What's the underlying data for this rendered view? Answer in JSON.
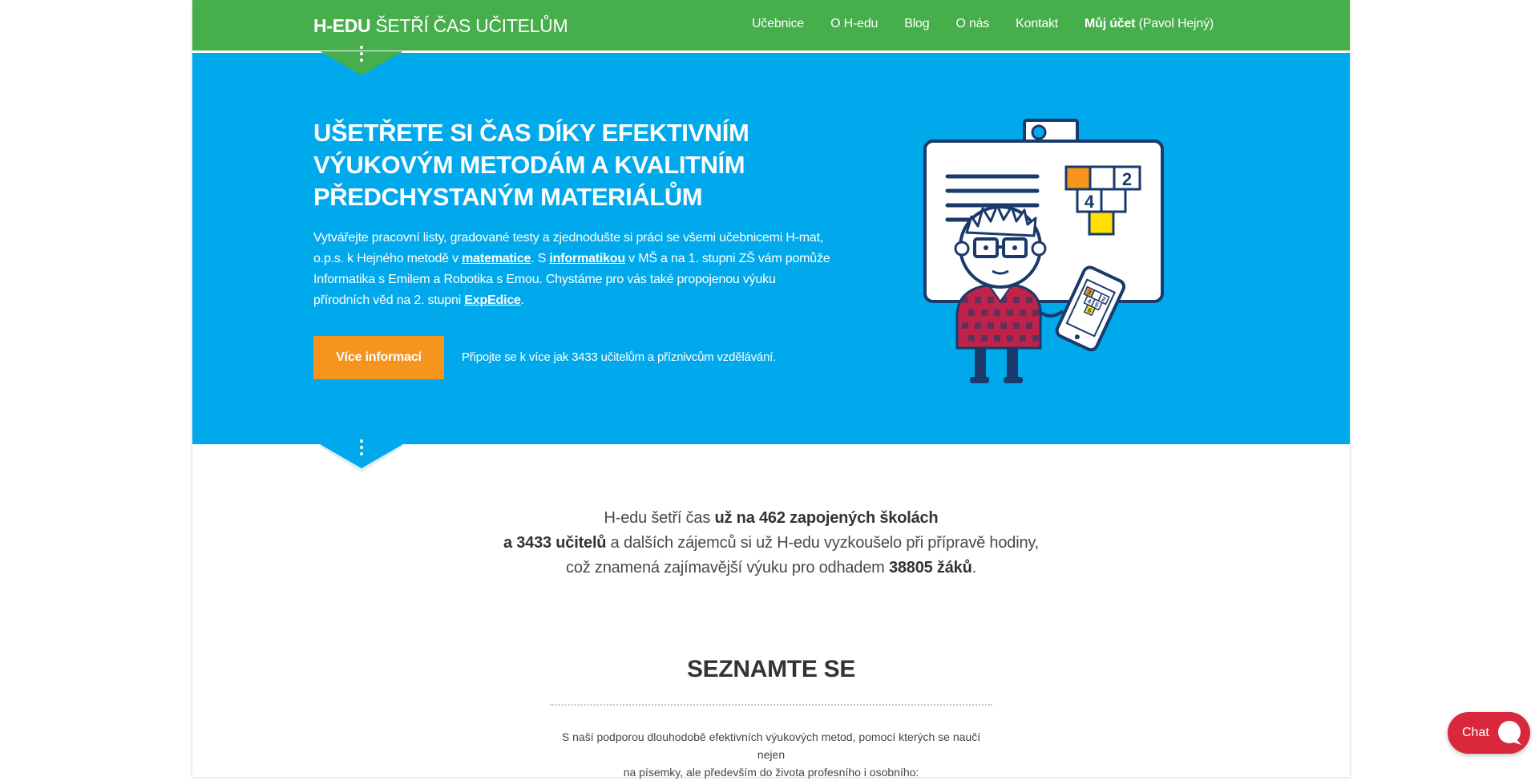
{
  "header": {
    "brand": "H-EDU",
    "tagline": "ŠETŘÍ ČAS UČITELŮM",
    "nav": [
      {
        "label": "Učebnice"
      },
      {
        "label": "O H-edu"
      },
      {
        "label": "Blog"
      },
      {
        "label": "O nás"
      },
      {
        "label": "Kontakt"
      }
    ],
    "account": {
      "label": "Můj účet",
      "user": "(Pavol Hejný)"
    }
  },
  "hero": {
    "title": "Ušetřete si čas díky efektivním výukovým metodám a kvalitním předchystaným materiálům",
    "intro": {
      "part1": "Vytvářejte pracovní listy, gradované testy a zjednodušte si práci se všemi učebnicemi H-mat, o.p.s. k Hejného metodě v ",
      "link1": "matematice",
      "part2": ". S ",
      "link2": "informatikou",
      "part3": " v MŠ a na 1. stupni ZŠ vám pomůže Informatika s Emilem a Robotika s Emou. Chystáme pro vás také propojenou výuku přírodních věd na 2. stupni ",
      "link3": "ExpEdice",
      "part4": "."
    },
    "cta_label": "Více informací",
    "join_text": "Připojte se k více jak 3433 učitelům a příznivcům vzdělávání.",
    "illustration": {
      "tile_a": "2",
      "tile_b": "4",
      "phone_a": "3",
      "phone_b": "2",
      "phone_c": "4",
      "phone_d": "5",
      "phone_e": "6"
    }
  },
  "stats": {
    "l1_text": "H-edu šetří čas ",
    "l1_bold": "už na 462 zapojených školách",
    "l2_bold": "a 3433 učitelů",
    "l2_text": " a dalších zájemců si už H-edu vyzkoušelo při přípravě hodiny,",
    "l3_text": "což znamená zajímavější výuku pro odhadem ",
    "l3_bold": "38805 žáků",
    "l3_end": "."
  },
  "section": {
    "title": "SEZNAMTE SE",
    "text_line1": "S naší podporou dlouhodobě efektivních výukových metod, pomocí kterých se naučí nejen",
    "text_line2": "na písemky, ale především do života profesního i osobního:"
  },
  "chat": {
    "label": "Chat"
  },
  "colors": {
    "header_green": "#46ae4a",
    "hero_blue": "#00a9ec",
    "cta_orange": "#f7941d",
    "chat_red": "#d9283c"
  }
}
